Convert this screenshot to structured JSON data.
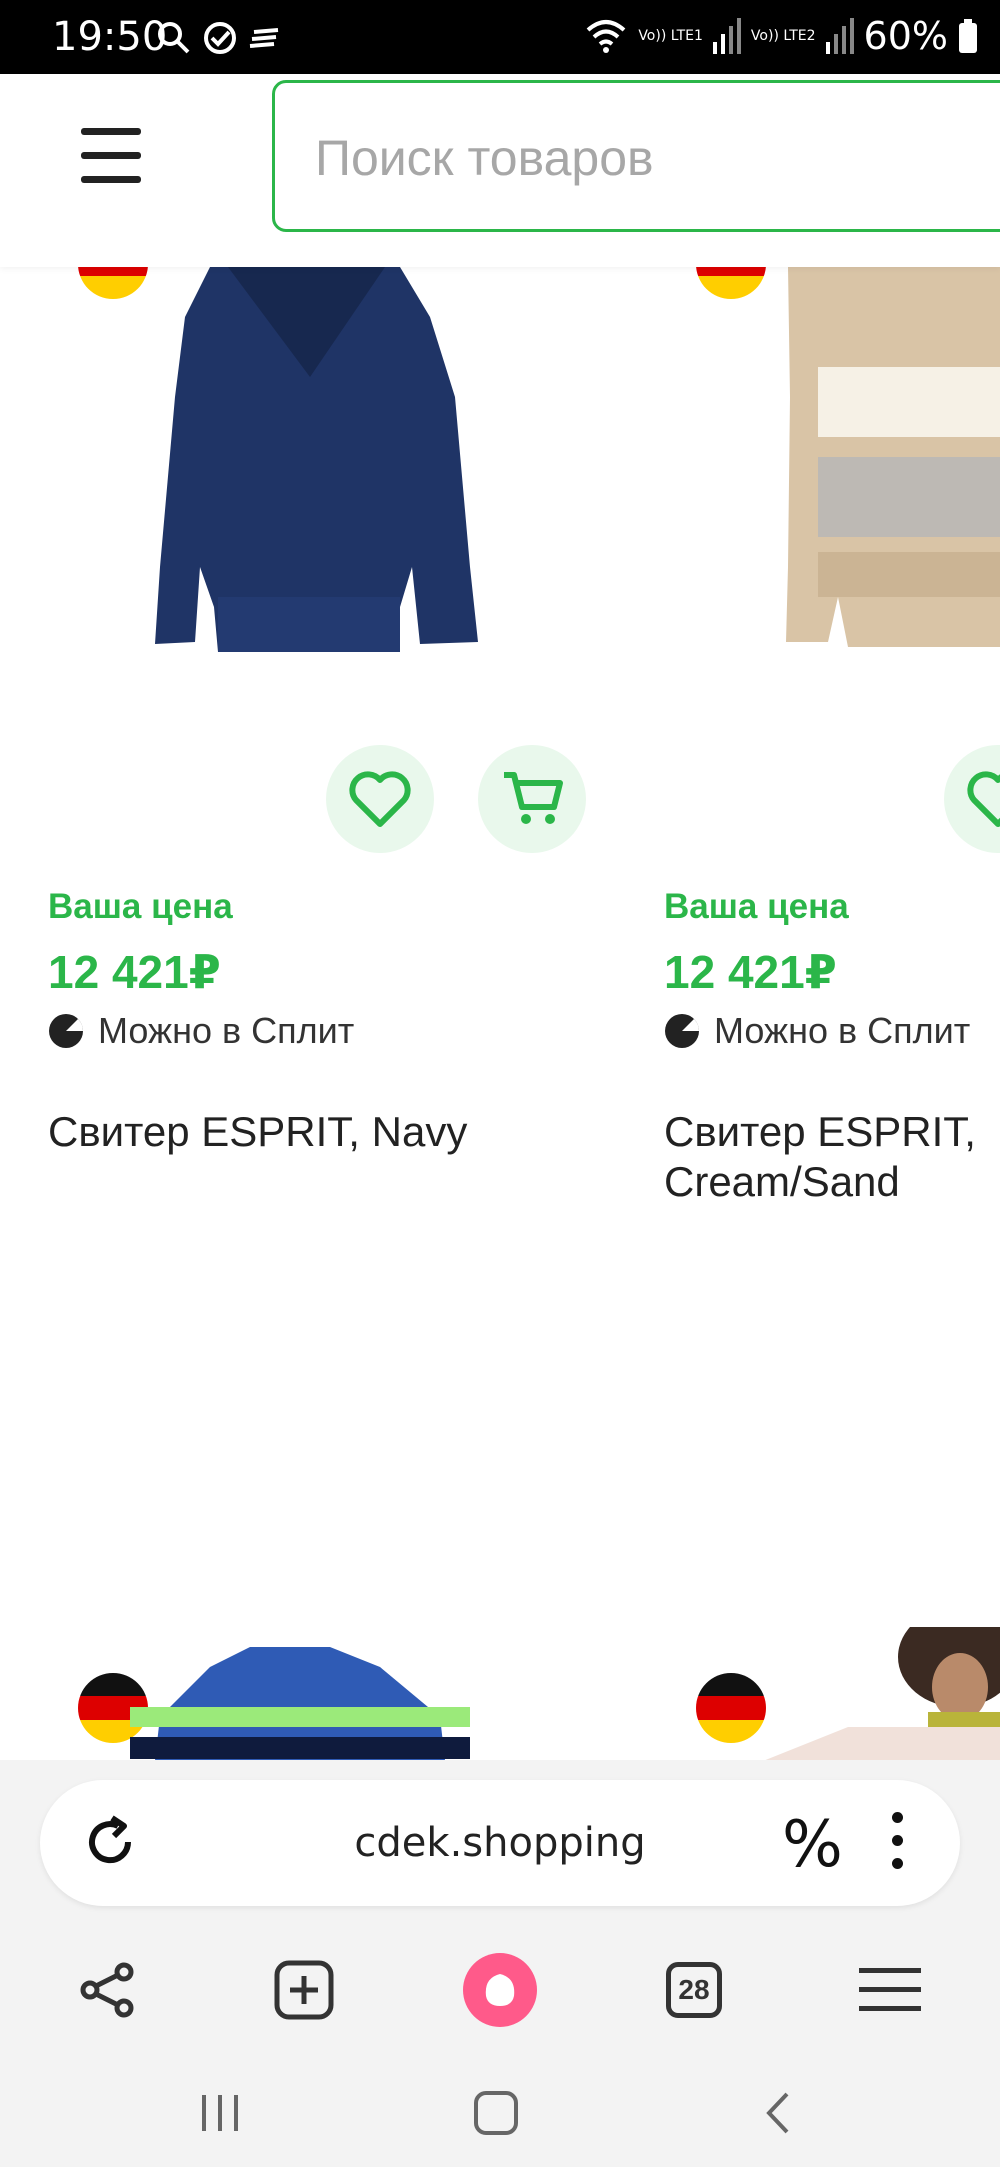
{
  "status_bar": {
    "time": "19:50",
    "sim1": "Vo)) LTE1",
    "sim2": "Vo)) LTE2",
    "battery": "60%"
  },
  "header": {
    "search_placeholder": "Поиск товаров"
  },
  "products": [
    {
      "price_label": "Ваша цена",
      "price": "12 421₽",
      "split_text": "Можно в Сплит",
      "title": "Свитер ESPRIT, Navy",
      "sweater_colors": [
        "#1f3466",
        "#2b4a86"
      ]
    },
    {
      "price_label": "Ваша цена",
      "price": "12 421₽",
      "split_text": "Можно в Сплит",
      "title": "Свитер ESPRIT, Cream/Sand",
      "sweater_colors": [
        "#d9c4a6",
        "#f6f1e6",
        "#bdb9b4"
      ]
    }
  ],
  "browser": {
    "url": "cdek.shopping",
    "tabs_count": "28",
    "discount_icon": "%"
  },
  "colors": {
    "accent_green": "#2bb649",
    "alice_pink": "#ff5a8a"
  }
}
